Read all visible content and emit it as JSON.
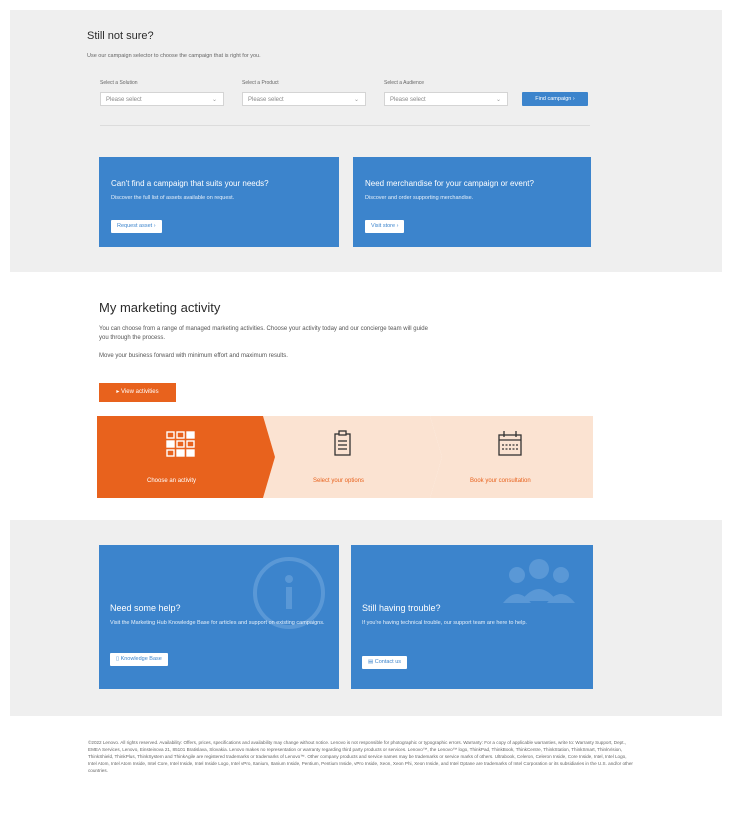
{
  "selector": {
    "title": "Still not sure?",
    "subtitle": "Use our campaign selector to choose the campaign that is right for you.",
    "fields": [
      {
        "label": "Select a Solution",
        "value": "Please select"
      },
      {
        "label": "Select a Product",
        "value": "Please select"
      },
      {
        "label": "Select a Audience",
        "value": "Please select"
      }
    ],
    "find_button": "Find campaign",
    "cards": [
      {
        "title": "Can't find a campaign that suits your needs?",
        "desc": "Discover the full list of assets available on request.",
        "button": "Request asset"
      },
      {
        "title": "Need merchandise for your campaign or event?",
        "desc": "Discover and order supporting merchandise.",
        "button": "Visit store"
      }
    ]
  },
  "activity": {
    "title": "My marketing activity",
    "desc1": "You can choose from a range of managed marketing activities. Choose your activity today and our concierge team will guide you through the process.",
    "desc2": "Move your business forward with minimum effort and maximum results.",
    "view_button": "View activities",
    "steps": [
      {
        "label": "Choose an activity",
        "icon": "grid-icon"
      },
      {
        "label": "Select your options",
        "icon": "clipboard-icon"
      },
      {
        "label": "Book your consultation",
        "icon": "calendar-icon"
      }
    ]
  },
  "help": {
    "cards": [
      {
        "title": "Need some help?",
        "desc": "Visit the Marketing Hub Knowledge Base for articles and support on existing campaigns.",
        "button": "Knowledge Base",
        "bg_icon": "info-icon"
      },
      {
        "title": "Still having trouble?",
        "desc": "If you're having technical trouble, our support team are here to help.",
        "button": "Contact us",
        "bg_icon": "users-icon"
      }
    ]
  },
  "footer": {
    "text": "©2022 Lenovo. All rights reserved. Availability: Offers, prices, specifications and availability may change without notice. Lenovo is not responsible for photographic or typographic errors. Warranty: For a copy of applicable warranties, write to: Warranty Support, Dept., EMEA Services, Lenovo, Einsteinova 21, 85101 Bratislava, Slovakia. Lenovo makes no representation or warranty regarding third party products or services. Lenovo™, the Lenovo™ logo, ThinkPad, ThinkBook, ThinkCentre, ThinkStation, ThinkSmart, ThinkVision, ThinkShield, ThinkPlus, ThinkSystem and ThinkAgile are registered trademarks or trademarks of Lenovo™. Other company products and service names may be trademarks or service marks of others. Ultrabook, Celeron, Celeron Inside, Core Inside, Intel, Intel Logo, Intel Atom, Intel Atom Inside, Intel Core, Intel Inside, Intel Inside Logo, Intel vPro, Itanium, Itanium Inside, Pentium, Pentium Inside, vPro Inside, Xeon, Xeon Phi, Xeon Inside, and Intel Optane are trademarks of Intel Corporation or its subsidiaries in the U.S. and/or other countries."
  },
  "colors": {
    "blue": "#3c84cc",
    "orange": "#e8621d",
    "peach": "#fbe3d2"
  }
}
